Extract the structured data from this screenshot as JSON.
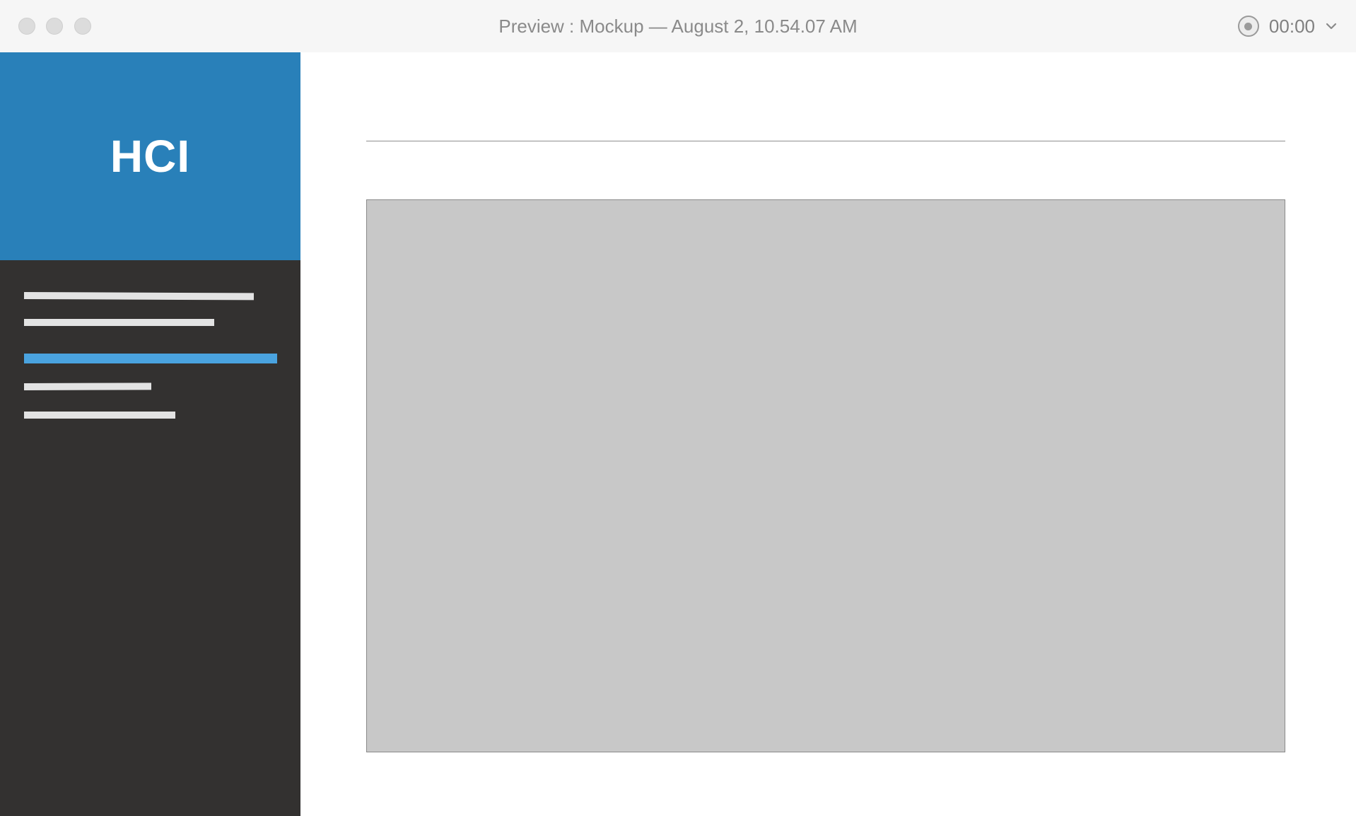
{
  "window": {
    "title": "Preview : Mockup — August 2, 10.54.07 AM"
  },
  "recording": {
    "timer": "00:00",
    "record_icon": "record-icon",
    "dropdown_icon": "chevron-down-icon"
  },
  "sidebar": {
    "brand": "HCI",
    "brand_color": "#2980b9",
    "background_color": "#333130",
    "active_color": "#4aa3df",
    "items": [
      {
        "active": false
      },
      {
        "active": false
      },
      {
        "active": true
      },
      {
        "active": false
      },
      {
        "active": false
      }
    ]
  },
  "main": {
    "placeholder_color": "#c8c8c8"
  }
}
